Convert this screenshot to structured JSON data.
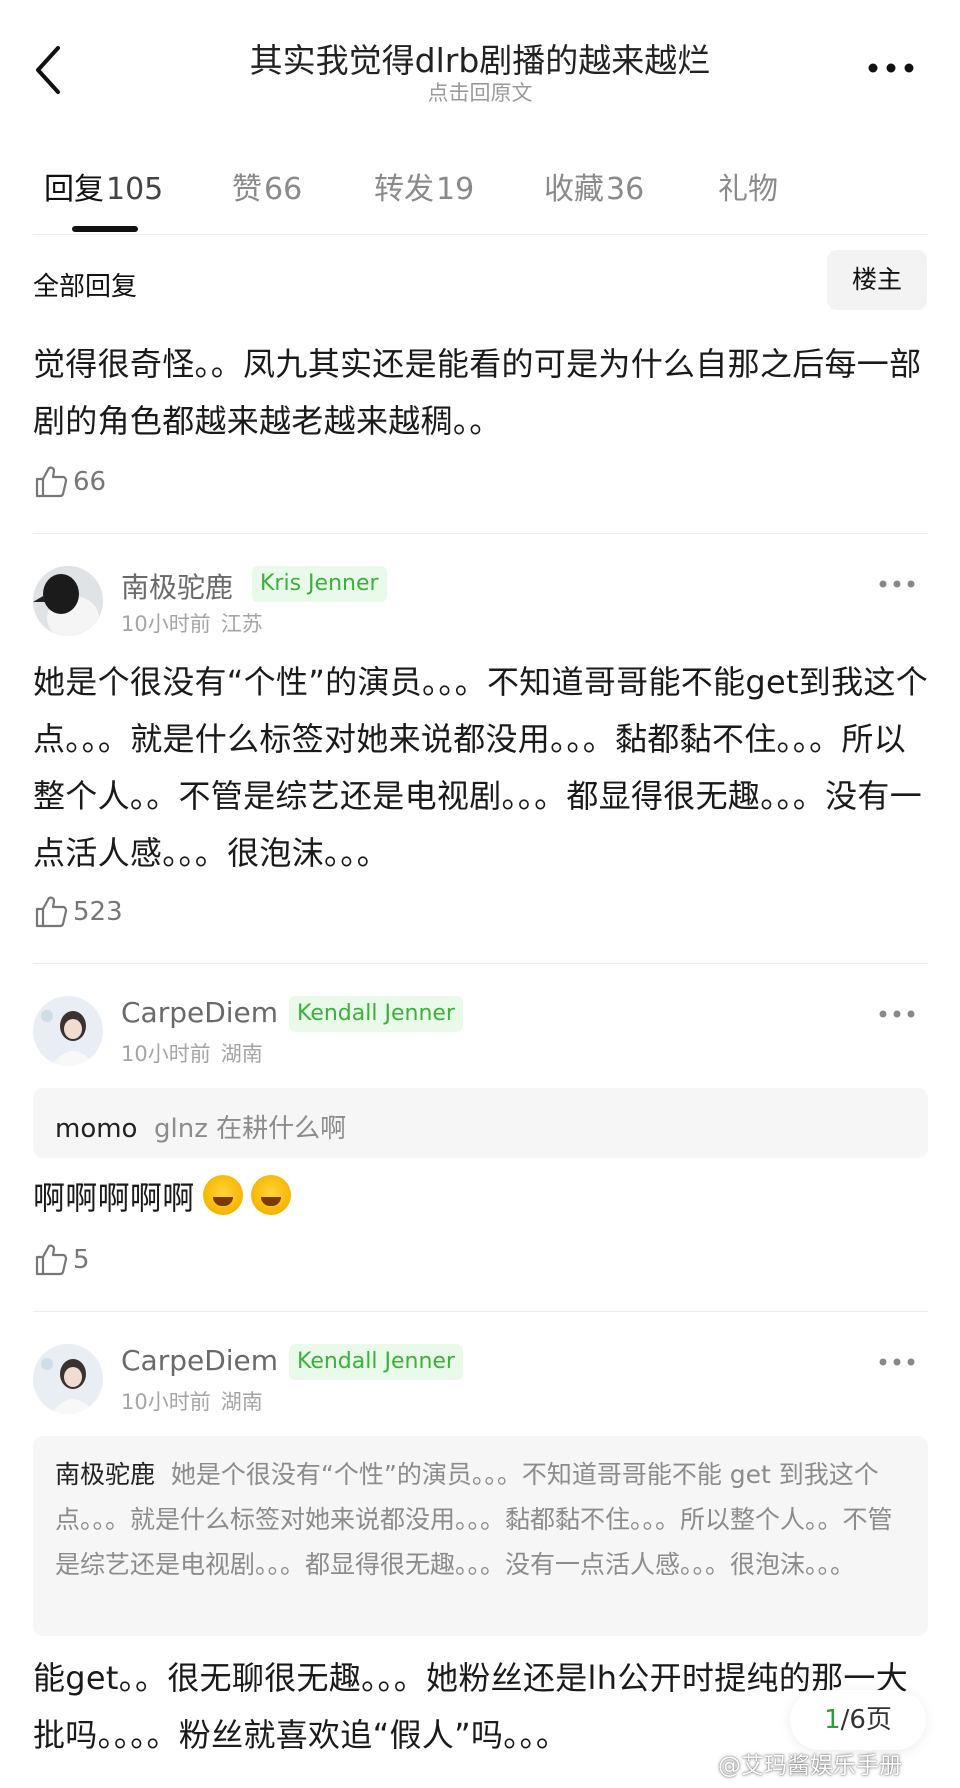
{
  "header": {
    "title": "其实我觉得dlrb剧播的越来越烂",
    "subtitle": "点击回原文"
  },
  "tabs": [
    {
      "label": "回复",
      "count": "105",
      "active": true
    },
    {
      "label": "赞",
      "count": "66"
    },
    {
      "label": "转发",
      "count": "19"
    },
    {
      "label": "收藏",
      "count": "36"
    },
    {
      "label": "礼物",
      "count": ""
    }
  ],
  "section": {
    "title": "全部回复",
    "owner_button": "楼主"
  },
  "post": {
    "text": "觉得很奇怪。。凤九其实还是能看的可是为什么自那之后每一部剧的角色都越来越老越来越稠。。",
    "likes": "66"
  },
  "comments": [
    {
      "username": "南极驼鹿",
      "badge": "Kris Jenner",
      "time": "10小时前",
      "location": "江苏",
      "text": "她是个很没有“个性”的演员。。。不知道哥哥能不能get到我这个点。。。就是什么标签对她来说都没用。。。黏都黏不住。。。所以整个人。。不管是综艺还是电视剧。。。都显得很无趣。。。没有一点活人感。。。很泡沫。。。",
      "likes": "523"
    },
    {
      "username": "CarpeDiem",
      "badge": "Kendall Jenner",
      "time": "10小时前",
      "location": "湖南",
      "quote_name": "momo",
      "quote_text": "glnz 在耕什么啊",
      "text": "啊啊啊啊啊",
      "likes": "5"
    },
    {
      "username": "CarpeDiem",
      "badge": "Kendall Jenner",
      "time": "10小时前",
      "location": "湖南",
      "quote_name": "南极驼鹿",
      "quote_text": "她是个很没有“个性”的演员。。。不知道哥哥能不能 get 到我这个点。。。就是什么标签对她来说都没用。。。黏都黏不住。。。所以整个人。。不管是综艺还是电视剧。。。都显得很无趣。。。没有一点活人感。。。很泡沫。。。",
      "text": "能get。。很无聊很无趣。。。她粉丝还是lh公开时提纯的那一大批吗。。。。粉丝就喜欢追“假人”吗。。。"
    }
  ],
  "pager": {
    "current": "1",
    "total": "/6页"
  },
  "watermark": "@艾玛酱娱乐手册",
  "icons": {
    "back": "chevron-left-icon",
    "more": "more-horizontal-icon",
    "like": "thumbs-up-icon",
    "emoji": "rolling-laughing-emoji-icon"
  },
  "colors": {
    "badge_bg": "#eafaea",
    "badge_text": "#3bb03b",
    "pager_current": "#2e9c3e"
  }
}
